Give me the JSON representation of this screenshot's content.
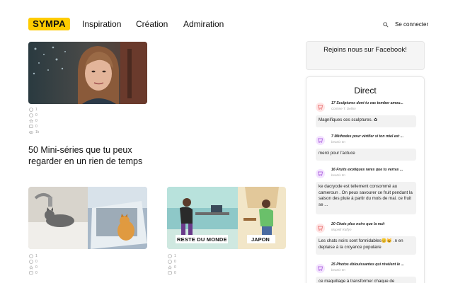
{
  "header": {
    "logo": "SYMPA",
    "nav": [
      "Inspiration",
      "Création",
      "Admiration"
    ],
    "login": "Se connecter"
  },
  "articles": [
    {
      "title": "50 Mini-séries que tu peux regarder en un rien de temps",
      "reactions": [
        "1",
        "0",
        "0",
        "0",
        "1k"
      ]
    },
    {
      "reactions": [
        "1",
        "0",
        "0",
        "0"
      ]
    },
    {
      "thumb_labels": [
        "RESTE DU MONDE",
        "JAPON"
      ],
      "reactions": [
        "1",
        "0",
        "0",
        "0"
      ]
    }
  ],
  "sidebar": {
    "facebook": "Rejoins nous sur Facebook!",
    "direct_title": "Direct",
    "feed": [
      {
        "title": "17 Sculptures dont tu vas tomber amou...",
        "author": "Corinne T. Dellon",
        "comment": "Magnifiques ces sculptures. ✿",
        "icon_color": "#ffe5e5",
        "icon_stroke": "#e45757"
      },
      {
        "title": "7 Méthodes pour vérifier si ton miel est ...",
        "author": "beatrix tm",
        "comment": "merci pour l'actuce",
        "icon_color": "#f3e3ff",
        "icon_stroke": "#a04ad8"
      },
      {
        "title": "16 Fruits exotiques rares que tu verras ...",
        "author": "beatrix tm",
        "comment": "ke dacryode est tellement consommé au cameroun . On peux savourer ce fruit pendant la saison des pluie à partir du mois de mai. ce fruit se ...",
        "icon_color": "#f3e3ff",
        "icon_stroke": "#a04ad8"
      },
      {
        "title": "20 Chats plus noirs que la nuit",
        "author": "Mapelli Raffyn",
        "comment": "Les chats noirs sont formidables😊😺 .n en deplaise à la croyance populaire",
        "icon_color": "#ffe5e5",
        "icon_stroke": "#e45757"
      },
      {
        "title": "25 Photos éblouissantes qui révèlent le ...",
        "author": "beatrix tm",
        "comment": "ce maquillage à transformer chaque de",
        "icon_color": "#f3e3ff",
        "icon_stroke": "#a04ad8"
      }
    ]
  }
}
